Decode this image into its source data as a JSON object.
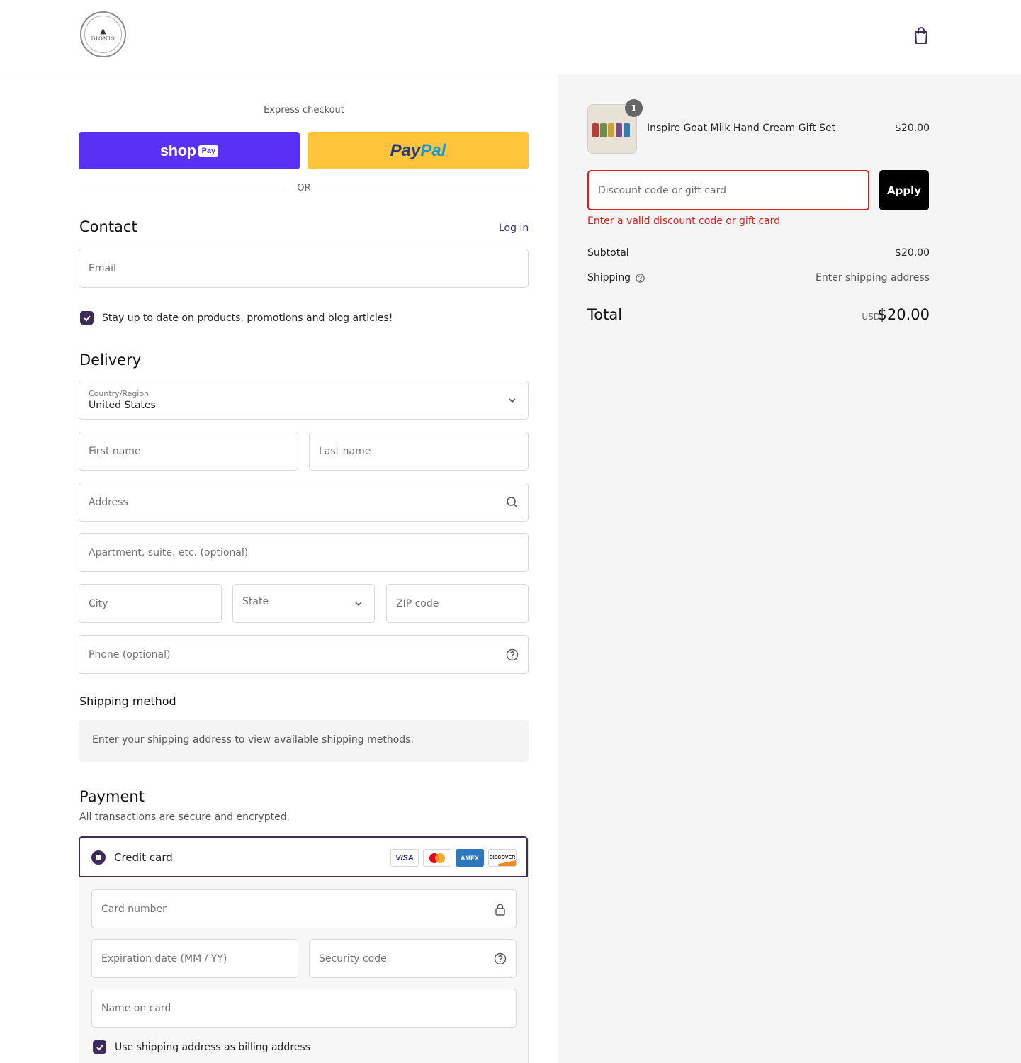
{
  "header": {
    "logo_text": "DIONIS",
    "cart_icon": "shopping-bag-icon"
  },
  "express": {
    "label": "Express checkout",
    "shop_pay": {
      "word": "shop",
      "pill": "Pay",
      "color": "#5a31f4"
    },
    "paypal": {
      "part1": "Pay",
      "part2": "Pal",
      "color": "#ffc439"
    },
    "or_label": "OR"
  },
  "contact": {
    "title": "Contact",
    "login_label": "Log in",
    "email_placeholder": "Email",
    "newsletter_label": "Stay up to date on products, promotions and blog articles!",
    "newsletter_checked": true
  },
  "delivery": {
    "title": "Delivery",
    "country_label": "Country/Region",
    "country_value": "United States",
    "first_name_placeholder": "First name",
    "last_name_placeholder": "Last name",
    "address_placeholder": "Address",
    "apartment_placeholder": "Apartment, suite, etc. (optional)",
    "city_placeholder": "City",
    "state_placeholder": "State",
    "zip_placeholder": "ZIP code",
    "phone_placeholder": "Phone (optional)"
  },
  "shipping_method": {
    "title": "Shipping method",
    "message": "Enter your shipping address to view available shipping methods."
  },
  "payment": {
    "title": "Payment",
    "subtitle": "All transactions are secure and encrypted.",
    "credit_card_label": "Credit card",
    "card_brands": [
      "VISA",
      "mastercard",
      "AMEX",
      "DISCOVER"
    ],
    "card_number_placeholder": "Card number",
    "expiration_placeholder": "Expiration date (MM / YY)",
    "security_placeholder": "Security code",
    "name_placeholder": "Name on card",
    "billing_same_label": "Use shipping address as billing address",
    "billing_same_checked": true
  },
  "summary": {
    "item": {
      "name": "Inspire Goat Milk Hand Cream Gift Set",
      "price": "$20.00",
      "quantity": "1"
    },
    "discount_placeholder": "Discount code or gift card",
    "apply_label": "Apply",
    "discount_error": "Enter a valid discount code or gift card",
    "subtotal_label": "Subtotal",
    "subtotal_value": "$20.00",
    "shipping_label": "Shipping",
    "shipping_value": "Enter shipping address",
    "total_label": "Total",
    "total_currency": "USD",
    "total_value": "$20.00"
  },
  "colors": {
    "accent": "#3f2a5e",
    "error": "#dd1d1d",
    "panel": "#f5f5f5"
  }
}
